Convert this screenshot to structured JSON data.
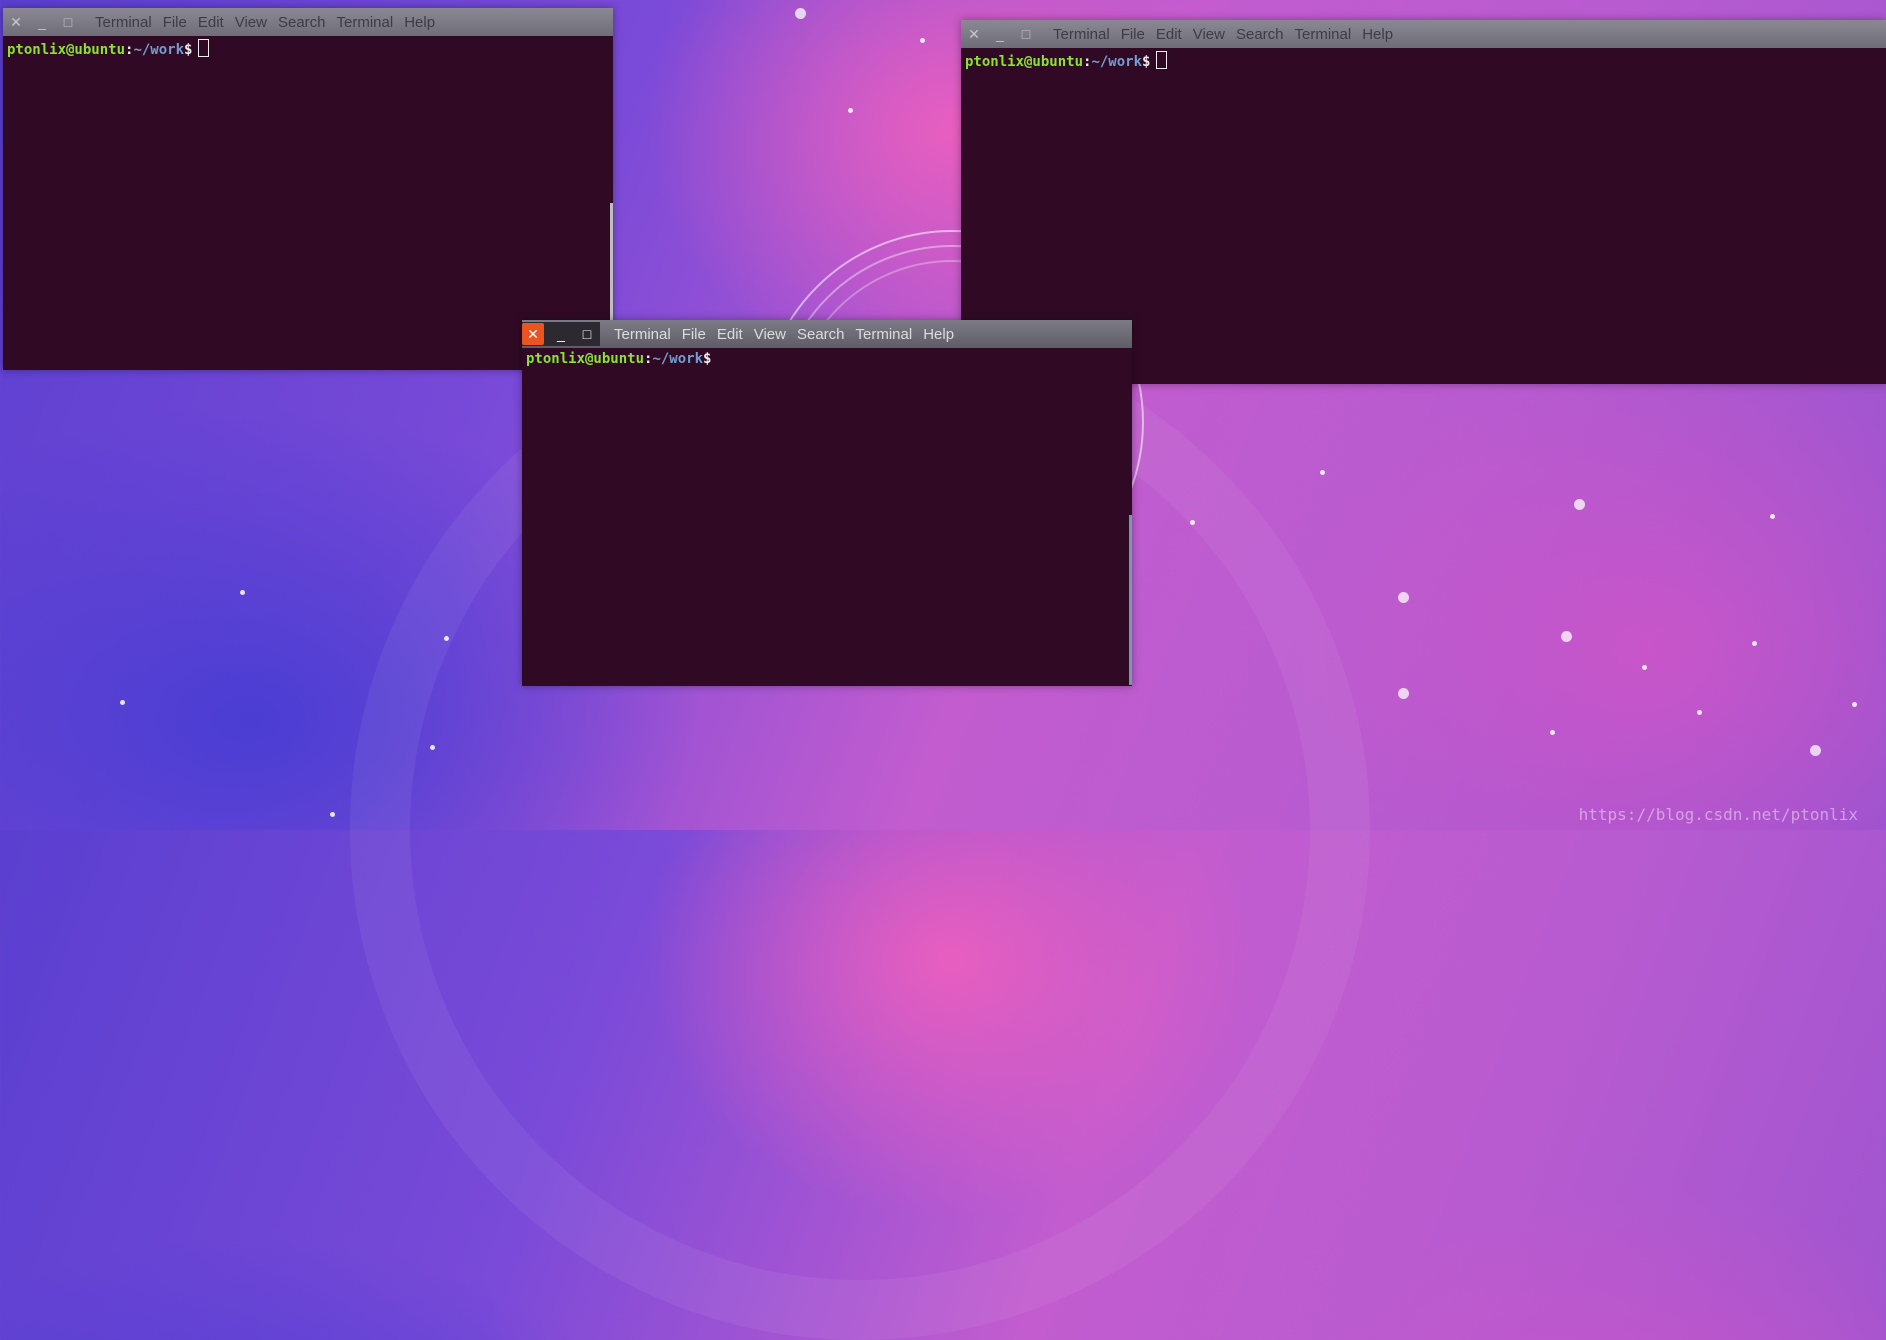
{
  "windows": [
    {
      "id": "top-left",
      "menu": [
        "Terminal",
        "File",
        "Edit",
        "View",
        "Search",
        "Terminal",
        "Help"
      ],
      "prompt": {
        "user_host": "ptonlix@ubuntu",
        "sep": ":",
        "path": "~/work",
        "symbol": "$"
      },
      "focused": false
    },
    {
      "id": "top-right",
      "menu": [
        "Terminal",
        "File",
        "Edit",
        "View",
        "Search",
        "Terminal",
        "Help"
      ],
      "prompt": {
        "user_host": "ptonlix@ubuntu",
        "sep": ":",
        "path": "~/work",
        "symbol": "$"
      },
      "focused": false
    },
    {
      "id": "bottom-center",
      "menu": [
        "Terminal",
        "File",
        "Edit",
        "View",
        "Search",
        "Terminal",
        "Help"
      ],
      "prompt": {
        "user_host": "ptonlix@ubuntu",
        "sep": ":",
        "path": "~/work",
        "symbol": "$"
      },
      "focused": true
    }
  ],
  "buttons": {
    "close": "✕",
    "minimize": "_",
    "maximize": "□"
  },
  "desktop": {
    "watermark": "https://blog.csdn.net/ptonlix"
  },
  "colors": {
    "terminal_bg": "#300a24",
    "close_active": "#e95420",
    "prompt_user": "#8ae234",
    "prompt_path": "#729fcf"
  }
}
